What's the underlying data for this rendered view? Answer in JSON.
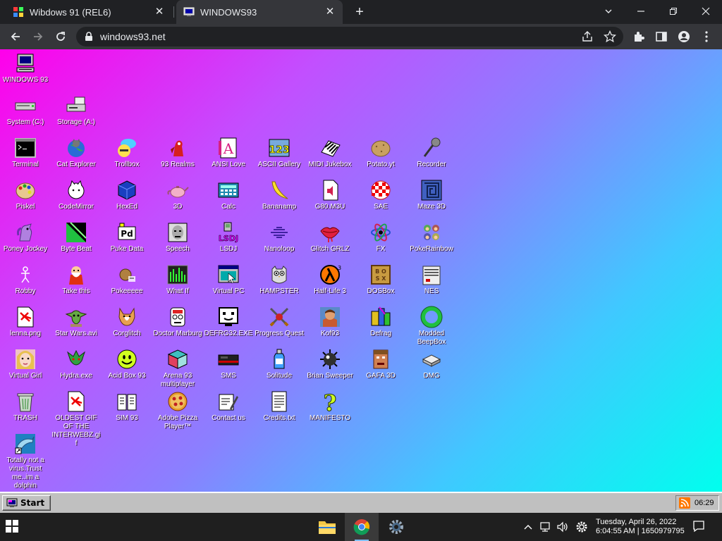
{
  "browser": {
    "tabs": [
      {
        "title": "Wibdows 91 (REL6)",
        "active": false
      },
      {
        "title": "WINDOWS93",
        "active": true
      }
    ],
    "url": "windows93.net"
  },
  "desktop": {
    "icons": [
      "WINDOWS 93",
      "System (C:)",
      "Storage (A:)",
      "Terminal",
      "Cat Explorer",
      "Trollbox",
      "93 Realms",
      "ANSI Love",
      "ASCII Gallery",
      "MIDI Jukebox",
      "Potato.yt",
      "Recorder",
      "Piskel",
      "CodeMirror",
      "HexEd",
      "3D",
      "Calc",
      "Bananamp",
      "G80.M3U",
      "SAE",
      "Maze 3D",
      "Poney Jockey",
      "Byte Beat",
      "Puke Data",
      "Speech",
      "LSDJ",
      "Nanoloop",
      "Glitch GRLZ",
      "FX",
      "PokeRainbow",
      "Robby",
      "Take this",
      "Pokeeeee",
      "What If",
      "Virtual PC",
      "HAMPSTER",
      "Half-Life 3",
      "DOSBox",
      "NES",
      "lenna.png",
      "Star Wars.avi",
      "Corglitch",
      "Doctor Marburg",
      "DEFRG32.EXE",
      "Progress Quest",
      "Kof93",
      "Defrag",
      "Modded BeepBox",
      "Virtual Girl",
      "Hydra.exe",
      "Acid Box 93",
      "Arena 93 multiplayer",
      "SMS",
      "Solitude",
      "Brian Sweeper",
      "GAFA 3D",
      "DMG",
      "TRASH",
      "OLDEST GIF OF THE INTERWEBZ.gif",
      "SIM 93",
      "Adobe Pizza Player™",
      "Contact us",
      "Credits.txt",
      "MANIFESTO",
      "Totally not a virus.Trust me..im a dolphin"
    ]
  },
  "w93taskbar": {
    "start_label": "Start",
    "tray_time": "06:29"
  },
  "windows": {
    "clock_line1": "Tuesday, April 26, 2022",
    "clock_line2": "6:04:55 AM | 1650979795"
  }
}
